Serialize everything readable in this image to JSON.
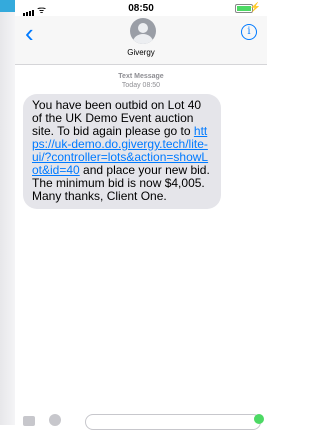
{
  "status_bar": {
    "time": "08:50"
  },
  "header": {
    "contact_name": "Givergy",
    "info_symbol": "i",
    "back_symbol": "‹"
  },
  "thread": {
    "kind": "Text Message",
    "day": "Today",
    "time": "08:50",
    "message": {
      "text_before": "You have been outbid on Lot 40 of the UK Demo Event auction site. To bid again please go to ",
      "link": "https://uk-demo.do.givergy.tech/lite-ui/?controller=lots&action=showLot&id=40",
      "text_after": " and place your new bid. The minimum bid is now $4,005. Many thanks, Client One."
    }
  },
  "colors": {
    "accent": "#007aff",
    "bubble": "#e5e5ea",
    "battery": "#4cd964"
  }
}
